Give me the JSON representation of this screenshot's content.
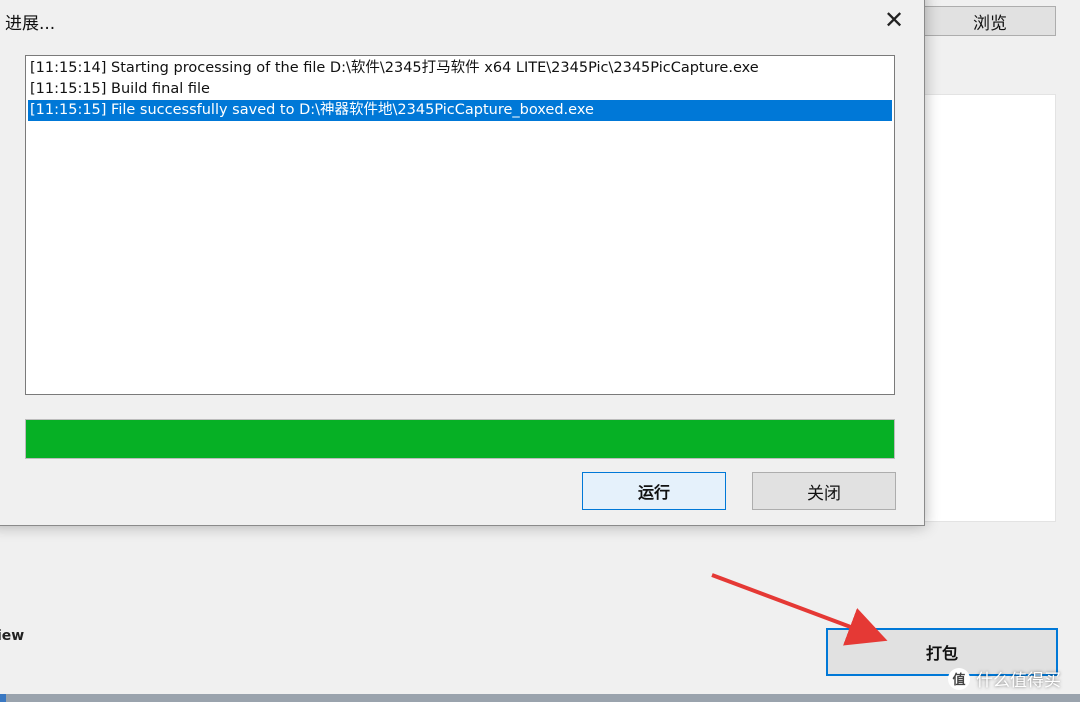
{
  "background": {
    "browse_label": "浏览",
    "left_text": "iew",
    "pack_label": "打包"
  },
  "dialog": {
    "title": "进展...",
    "close_glyph": "✕",
    "log": [
      "[11:15:14] Starting processing of the file D:\\软件\\2345打马软件 x64 LITE\\2345Pic\\2345PicCapture.exe",
      "[11:15:15] Build final file",
      "[11:15:15] File successfully saved to D:\\神器软件地\\2345PicCapture_boxed.exe"
    ],
    "selected_index": 2,
    "progress": 1.0,
    "run_label": "运行",
    "close_label": "关闭"
  },
  "watermark": {
    "icon_glyph": "值",
    "text": "什么值得买"
  },
  "colors": {
    "accent": "#0078d7",
    "progress": "#06b025",
    "annotation_arrow": "#e53935"
  },
  "icons": {
    "close": "close-icon",
    "annotation": "red-arrow-icon",
    "watermark": "watermark-logo-icon"
  }
}
